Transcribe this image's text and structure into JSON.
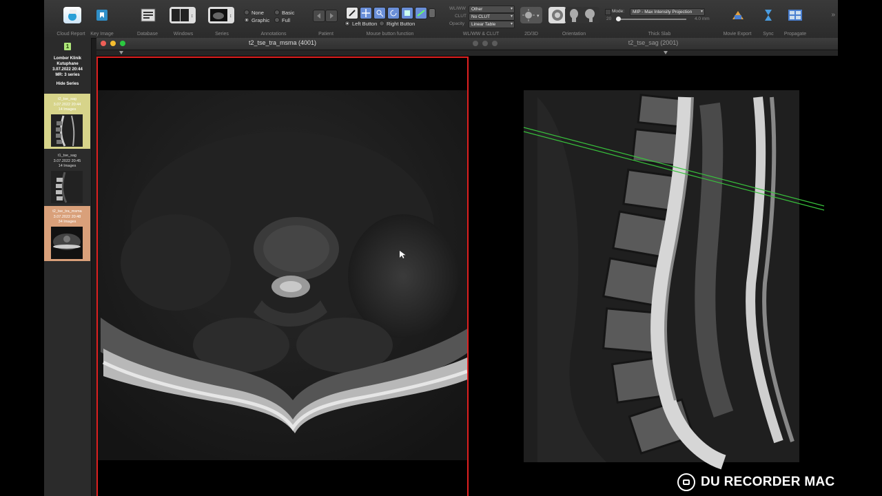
{
  "toolbar": {
    "groups": {
      "cloud_report": "Cloud Report",
      "key_image": "Key Image",
      "database": "Database",
      "windows": "Windows",
      "series": "Series",
      "annotations": "Annotations",
      "patient": "Patient",
      "mouse_function": "Mouse button function",
      "wlww_clut": "WL/WW & CLUT",
      "view_2d3d": "2D/3D",
      "orientation": "Orientation",
      "thick_slab": "Thick Slab",
      "movie_export": "Movie Export",
      "sync": "Sync",
      "propagate": "Propagate"
    },
    "annotations": {
      "none": "None",
      "basic": "Basic",
      "graphic": "Graphic",
      "full": "Full"
    },
    "mouse": {
      "left": "Left Button",
      "right": "Right Button"
    },
    "wlww": {
      "wlww_label": "WL/WW",
      "wlww_value": "Other",
      "clut_label": "CLUT",
      "clut_value": "No CLUT",
      "opacity_label": "Opacity",
      "opacity_value": "Linear Table"
    },
    "thick_slab": {
      "mode_label": "Mode:",
      "mode_value": "MIP - Max Intensity Projection",
      "count": "20",
      "thickness": "4.0 mm"
    }
  },
  "study": {
    "number": "1",
    "name": "Lomber Klinik",
    "name2": "Kutuphane",
    "date": "3.07.2022 20:44",
    "series_info": "MR: 3 series",
    "hide_series": "Hide Series"
  },
  "series_list": [
    {
      "name": "t2_tse_sag",
      "date": "3.07.2022 20:44",
      "images": "14 Images",
      "color": "#d7d48a"
    },
    {
      "name": "t1_tse_sag",
      "date": "3.07.2022 20:45",
      "images": "14 Images",
      "color": "#2b2b2b"
    },
    {
      "name": "t2_tse_tra_msma",
      "date": "3.07.2022 20:48",
      "images": "34 Images",
      "color": "#d9a07a"
    }
  ],
  "viewers": {
    "left": {
      "title": "t2_tse_tra_msma (4001)",
      "border_color": "#e02020"
    },
    "right": {
      "title": "t2_tse_sag (2001)"
    }
  },
  "watermark": "DU RECORDER MAC",
  "colors": {
    "accent": "#e02020",
    "badge": "#aee67a",
    "localizer": "#38c43c"
  }
}
